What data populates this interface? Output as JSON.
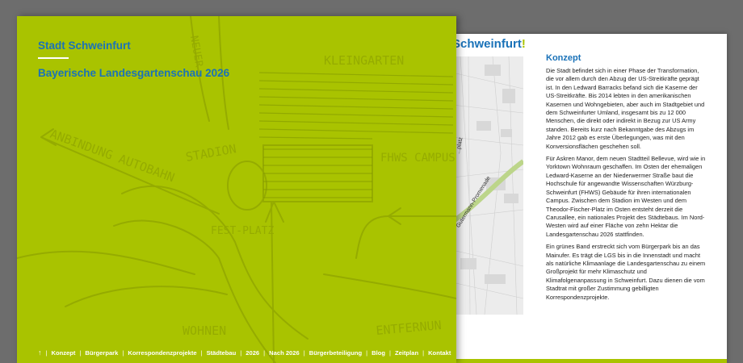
{
  "back_page": {
    "title_main": "Schweinfurt",
    "title_mark": "!",
    "map_labels": [
      "...platz",
      "Gutermann-Promenade"
    ],
    "section_title": "Konzept",
    "paragraphs": [
      "Die Stadt befindet sich in einer Phase der Transformation, die vor allem durch den Abzug der US-Streitkräfte geprägt ist. In den Ledward Barracks befand sich die Kaserne der US-Streitkräfte. Bis 2014 lebten in den amerikanischen Kasernen und Wohngebieten, aber auch im Stadtgebiet und dem Schweinfurter Umland, insgesamt bis zu 12 000 Menschen, die direkt oder indirekt in Bezug zur US Army standen. Bereits kurz nach Bekanntgabe des Abzugs im Jahre 2012 gab es erste Überlegungen, was mit den Konversionsflächen geschehen soll.",
      "Für Askren Manor, dem neuen Stadtteil Bellevue, wird wie in Yorktown Wohnraum geschaffen. Im Osten der ehemaligen Ledward-Kaserne an der Niederwermer Straße baut die Hochschule für angewandte Wissenschaften Würzburg-Schweinfurt (FHWS) Gebäude für ihren internationalen Campus. Zwischen dem Stadion im Westen und dem Theodor-Fischer-Platz im Osten entsteht derzeit die Carusallee, ein nationales Projekt des Städtebaus. Im Nord-Westen wird auf einer Fläche von zehn Hektar die Landesgartenschau 2026 stattfinden.",
      "Ein grünes Band erstreckt sich vom Bürgerpark bis an das Mainufer. Es trägt die LGS bis in die Innenstadt und macht als natürliche Klimaanlage die Landesgartenschau zu einem Großprojekt für mehr Klimaschutz und Klimafolgenanpassung in Schweinfurt. Dazu dienen die vom Stadtrat mit großer Zustimmung gebilligten Korrespondenzprojekte."
    ]
  },
  "front_page": {
    "brand": "Stadt Schweinfurt",
    "subtitle": "Bayerische Landesgartenschau 2026",
    "sketch_labels": [
      "KLEINGARTEN",
      "ANBINDUNG AUTOBAHN",
      "STADION",
      "FHWS CAMPUS 2",
      "FEST-PLATZ",
      "ENTFERNUN",
      "NEUER",
      "WOHNEN"
    ],
    "footer_nav": {
      "up_icon": "↑",
      "items": [
        "Konzept",
        "Bürgerpark",
        "Korrespondenzprojekte",
        "Städtebau",
        "2026",
        "Nach 2026",
        "Bürgerbeteiligung",
        "Blog",
        "Zeitplan",
        "Kontakt"
      ]
    }
  },
  "colors": {
    "background": "#6d6d6d",
    "accent_green": "#a9c300",
    "brand_blue": "#1a72b8"
  }
}
